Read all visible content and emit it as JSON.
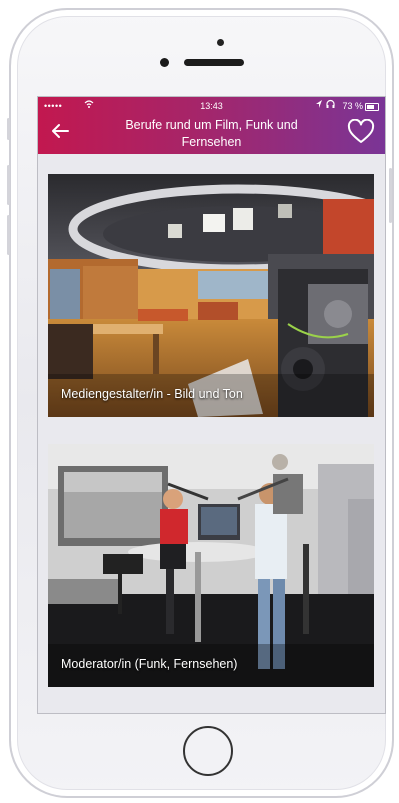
{
  "status_bar": {
    "carrier": "•••••",
    "time": "13:43",
    "battery": "73 %"
  },
  "header": {
    "title": "Berufe rund um Film, Funk und Fernsehen",
    "back_icon": "arrow-left-icon",
    "favorite_icon": "heart-outline-icon"
  },
  "cards": [
    {
      "label": "Mediengestalter/in - Bild und Ton",
      "image": "tv-studio-photo"
    },
    {
      "label": "Moderator/in (Funk, Fernsehen)",
      "image": "radio-studio-photo"
    }
  ],
  "colors": {
    "header_start": "#c2184f",
    "header_end": "#7a3596"
  }
}
